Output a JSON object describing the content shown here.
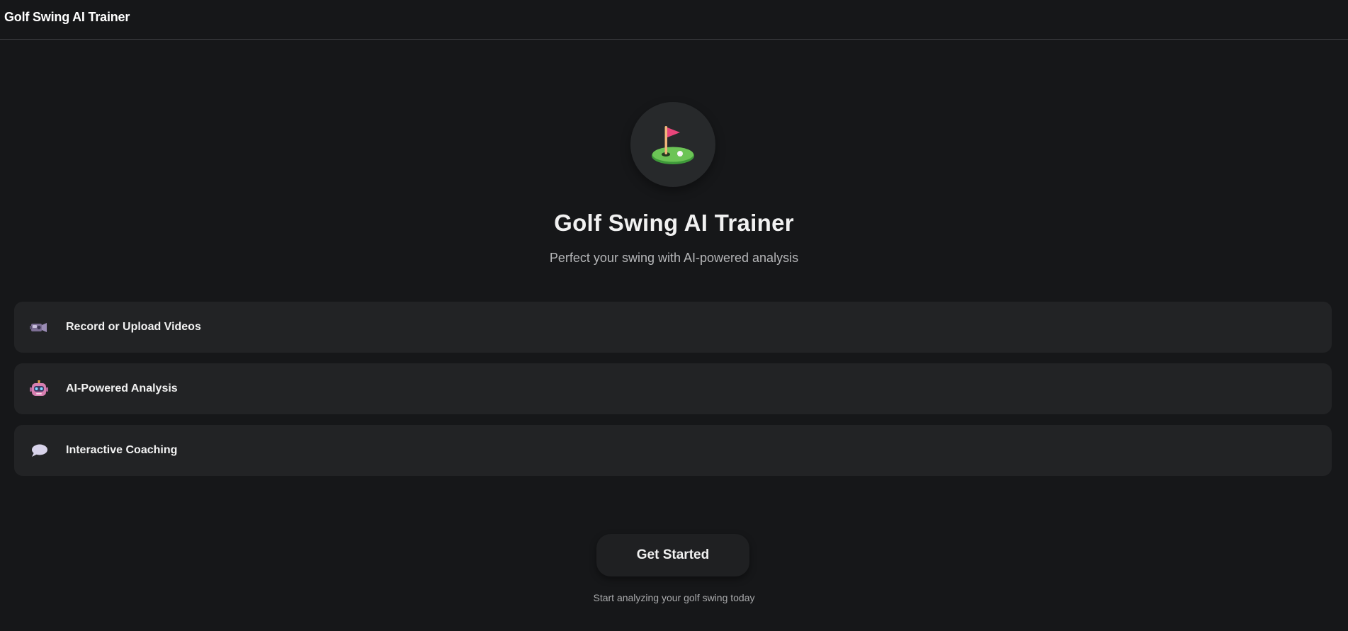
{
  "header": {
    "title": "Golf Swing AI Trainer"
  },
  "hero": {
    "icon": "golf-flag-hole-icon",
    "title": "Golf Swing AI Trainer",
    "subtitle": "Perfect your swing with AI-powered analysis"
  },
  "features": [
    {
      "icon": "video-camera-icon",
      "label": "Record or Upload Videos"
    },
    {
      "icon": "robot-icon",
      "label": "AI-Powered Analysis"
    },
    {
      "icon": "speech-bubble-icon",
      "label": "Interactive Coaching"
    }
  ],
  "cta": {
    "label": "Get Started",
    "caption": "Start analyzing your golf swing today"
  },
  "colors": {
    "background": "#161719",
    "card": "#222325",
    "flag": "#e8457a",
    "green": "#5fbf4d"
  }
}
